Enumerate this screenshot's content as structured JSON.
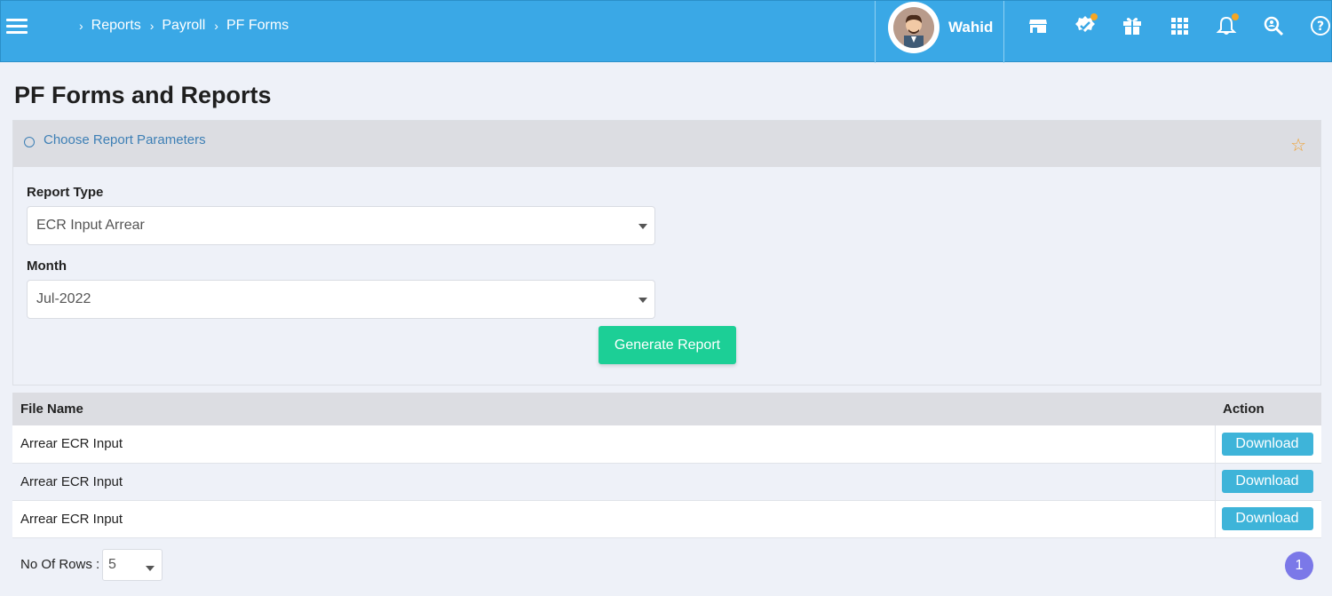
{
  "breadcrumb": [
    "Reports",
    "Payroll",
    "PF Forms"
  ],
  "user": {
    "name": "Wahid"
  },
  "top_icons": [
    "store-icon",
    "verified-badge-icon",
    "gift-icon",
    "apps-grid-icon",
    "bell-icon",
    "search-user-icon",
    "help-icon"
  ],
  "page": {
    "title": "PF Forms and Reports"
  },
  "params": {
    "header": "Choose Report Parameters",
    "report_type_label": "Report Type",
    "report_type_value": "ECR Input Arrear",
    "month_label": "Month",
    "month_value": "Jul-2022",
    "generate_label": "Generate Report"
  },
  "table": {
    "headers": {
      "file_name": "File Name",
      "action": "Action"
    },
    "rows": [
      {
        "file_name": "Arrear ECR Input",
        "action": "Download"
      },
      {
        "file_name": "Arrear ECR Input",
        "action": "Download"
      },
      {
        "file_name": "Arrear ECR Input",
        "action": "Download"
      }
    ]
  },
  "footer": {
    "rows_label": "No Of Rows :",
    "rows_value": "5",
    "page": "1"
  },
  "colors": {
    "topbar": "#3aa8e6",
    "generate": "#1ccf96",
    "download": "#3eb4d9",
    "pagination": "#7b78e8",
    "star": "#f0a030"
  }
}
